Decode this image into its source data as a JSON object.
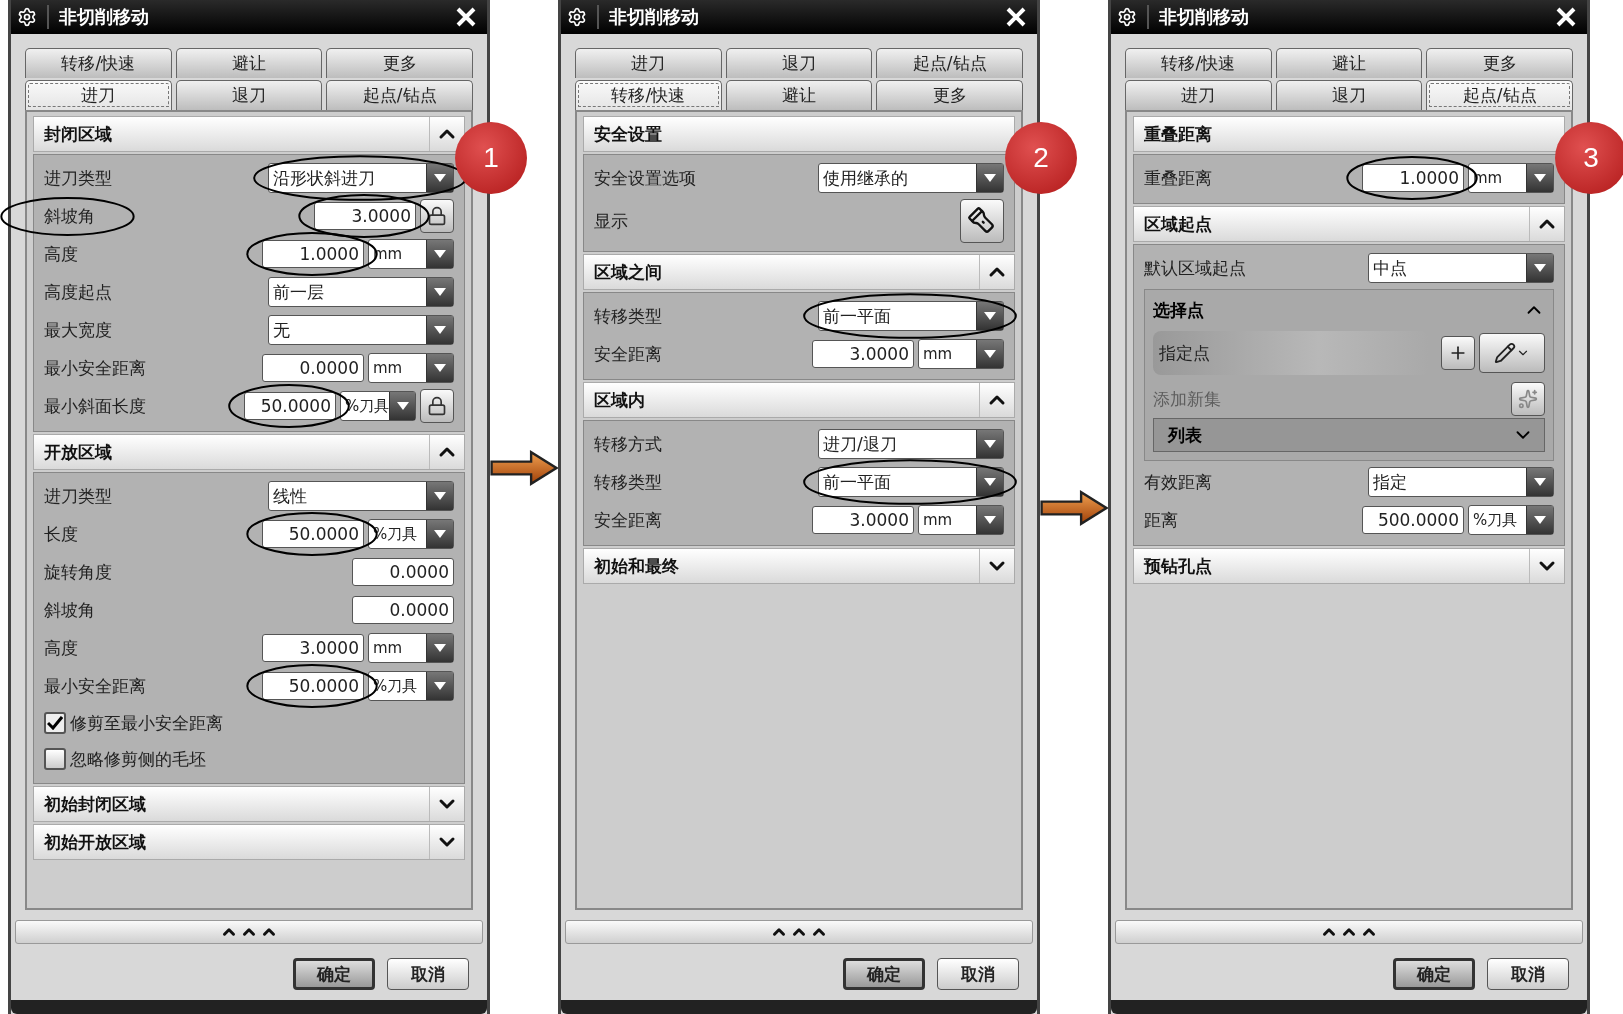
{
  "dialogs": [
    {
      "title": "非切削移动",
      "badge": "1",
      "tab_rows": [
        [
          {
            "label": "转移/快速",
            "selected": false
          },
          {
            "label": "避让",
            "selected": false
          },
          {
            "label": "更多",
            "selected": false
          }
        ],
        [
          {
            "label": "进刀",
            "selected": true
          },
          {
            "label": "退刀",
            "selected": false
          },
          {
            "label": "起点/钻点",
            "selected": false
          }
        ]
      ],
      "sections": [
        {
          "title": "封闭区域",
          "expanded": true,
          "rows": [
            {
              "kind": "dropdown",
              "label": "进刀类型",
              "value": "沿形状斜进刀",
              "circled": true
            },
            {
              "kind": "number",
              "label": "斜坡角",
              "value": "3.0000",
              "lock": true,
              "circled": true,
              "label_circled": true
            },
            {
              "kind": "number",
              "label": "高度",
              "value": "1.0000",
              "unit": "mm",
              "circled": true
            },
            {
              "kind": "dropdown",
              "label": "高度起点",
              "value": "前一层"
            },
            {
              "kind": "dropdown",
              "label": "最大宽度",
              "value": "无"
            },
            {
              "kind": "number",
              "label": "最小安全距离",
              "value": "0.0000",
              "unit": "mm"
            },
            {
              "kind": "number",
              "label": "最小斜面长度",
              "value": "50.0000",
              "unit": "%刀具",
              "lock": true,
              "circled": true
            }
          ]
        },
        {
          "title": "开放区域",
          "expanded": true,
          "rows": [
            {
              "kind": "dropdown",
              "label": "进刀类型",
              "value": "线性"
            },
            {
              "kind": "number",
              "label": "长度",
              "value": "50.0000",
              "unit": "%刀具",
              "circled": true
            },
            {
              "kind": "number",
              "label": "旋转角度",
              "value": "0.0000"
            },
            {
              "kind": "number",
              "label": "斜坡角",
              "value": "0.0000"
            },
            {
              "kind": "number",
              "label": "高度",
              "value": "3.0000",
              "unit": "mm"
            },
            {
              "kind": "number",
              "label": "最小安全距离",
              "value": "50.0000",
              "unit": "%刀具",
              "circled": true
            },
            {
              "kind": "checkbox",
              "label": "修剪至最小安全距离",
              "checked": true
            },
            {
              "kind": "checkbox",
              "label": "忽略修剪侧的毛坯",
              "checked": false
            }
          ]
        },
        {
          "title": "初始封闭区域",
          "expanded": false
        },
        {
          "title": "初始开放区域",
          "expanded": false
        }
      ],
      "buttons": [
        {
          "label": "确定",
          "default": true
        },
        {
          "label": "取消",
          "default": false
        }
      ]
    },
    {
      "title": "非切削移动",
      "badge": "2",
      "tab_rows": [
        [
          {
            "label": "进刀",
            "selected": false
          },
          {
            "label": "退刀",
            "selected": false
          },
          {
            "label": "起点/钻点",
            "selected": false
          }
        ],
        [
          {
            "label": "转移/快速",
            "selected": true
          },
          {
            "label": "避让",
            "selected": false
          },
          {
            "label": "更多",
            "selected": false
          }
        ]
      ],
      "sections": [
        {
          "title": "安全设置",
          "rows": [
            {
              "kind": "dropdown",
              "label": "安全设置选项",
              "value": "使用继承的"
            },
            {
              "kind": "icon_button",
              "label": "显示"
            }
          ]
        },
        {
          "title": "区域之间",
          "expanded": true,
          "rows": [
            {
              "kind": "dropdown",
              "label": "转移类型",
              "value": "前一平面",
              "circled": true
            },
            {
              "kind": "number",
              "label": "安全距离",
              "value": "3.0000",
              "unit": "mm"
            }
          ]
        },
        {
          "title": "区域内",
          "expanded": true,
          "rows": [
            {
              "kind": "dropdown",
              "label": "转移方式",
              "value": "进刀/退刀"
            },
            {
              "kind": "dropdown",
              "label": "转移类型",
              "value": "前一平面",
              "circled": true
            },
            {
              "kind": "number",
              "label": "安全距离",
              "value": "3.0000",
              "unit": "mm"
            }
          ]
        },
        {
          "title": "初始和最终",
          "expanded": false
        }
      ],
      "buttons": [
        {
          "label": "确定",
          "default": true
        },
        {
          "label": "取消",
          "default": false
        }
      ]
    },
    {
      "title": "非切削移动",
      "badge": "3",
      "tab_rows": [
        [
          {
            "label": "转移/快速",
            "selected": false
          },
          {
            "label": "避让",
            "selected": false
          },
          {
            "label": "更多",
            "selected": false
          }
        ],
        [
          {
            "label": "进刀",
            "selected": false
          },
          {
            "label": "退刀",
            "selected": false
          },
          {
            "label": "起点/钻点",
            "selected": true
          }
        ]
      ],
      "sections": [
        {
          "title": "重叠距离",
          "rows": [
            {
              "kind": "number",
              "label": "重叠距离",
              "value": "1.0000",
              "unit": "mm",
              "circled": true
            }
          ]
        },
        {
          "title": "区域起点",
          "expanded": true,
          "rows": [
            {
              "kind": "dropdown",
              "label": "默认区域起点",
              "value": "中点"
            },
            {
              "kind": "subsection",
              "title": "选择点",
              "expanded": true,
              "rows": [
                {
                  "kind": "point",
                  "label": "指定点"
                },
                {
                  "kind": "action",
                  "label": "添加新集",
                  "disabled": true
                },
                {
                  "kind": "list_bar",
                  "title": "列表",
                  "expanded": false
                }
              ]
            },
            {
              "kind": "dropdown",
              "label": "有效距离",
              "value": "指定"
            },
            {
              "kind": "number",
              "label": "距离",
              "value": "500.0000",
              "unit": "%刀具"
            }
          ]
        },
        {
          "title": "预钻孔点",
          "expanded": false
        }
      ],
      "buttons": [
        {
          "label": "确定",
          "default": true
        },
        {
          "label": "取消",
          "default": false
        }
      ]
    }
  ]
}
